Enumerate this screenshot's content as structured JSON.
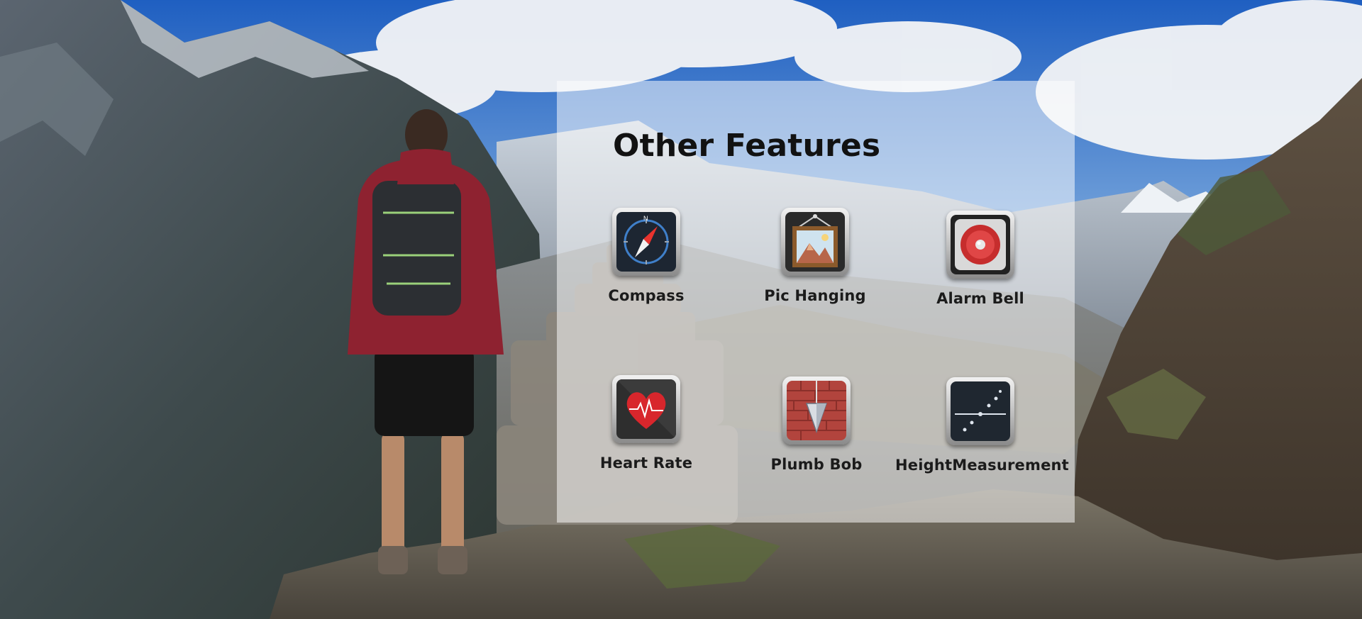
{
  "page": {
    "title": "Other Features"
  },
  "features": [
    {
      "label": "Compass",
      "icon": "compass-icon"
    },
    {
      "label": "Pic Hanging",
      "icon": "picture-frame-icon"
    },
    {
      "label": "Alarm Bell",
      "icon": "alarm-bell-icon"
    },
    {
      "label": "Heart Rate",
      "icon": "heart-rate-icon"
    },
    {
      "label": "Plumb Bob",
      "icon": "plumb-bob-icon"
    },
    {
      "label": "HeightMeasurement",
      "icon": "height-measurement-icon"
    }
  ],
  "colors": {
    "panel_overlay": "#ffffffcc",
    "title_text": "#121212",
    "heart_red": "#d8262c",
    "brick_red": "#b2443d",
    "sky_blue": "#2a68c4"
  }
}
